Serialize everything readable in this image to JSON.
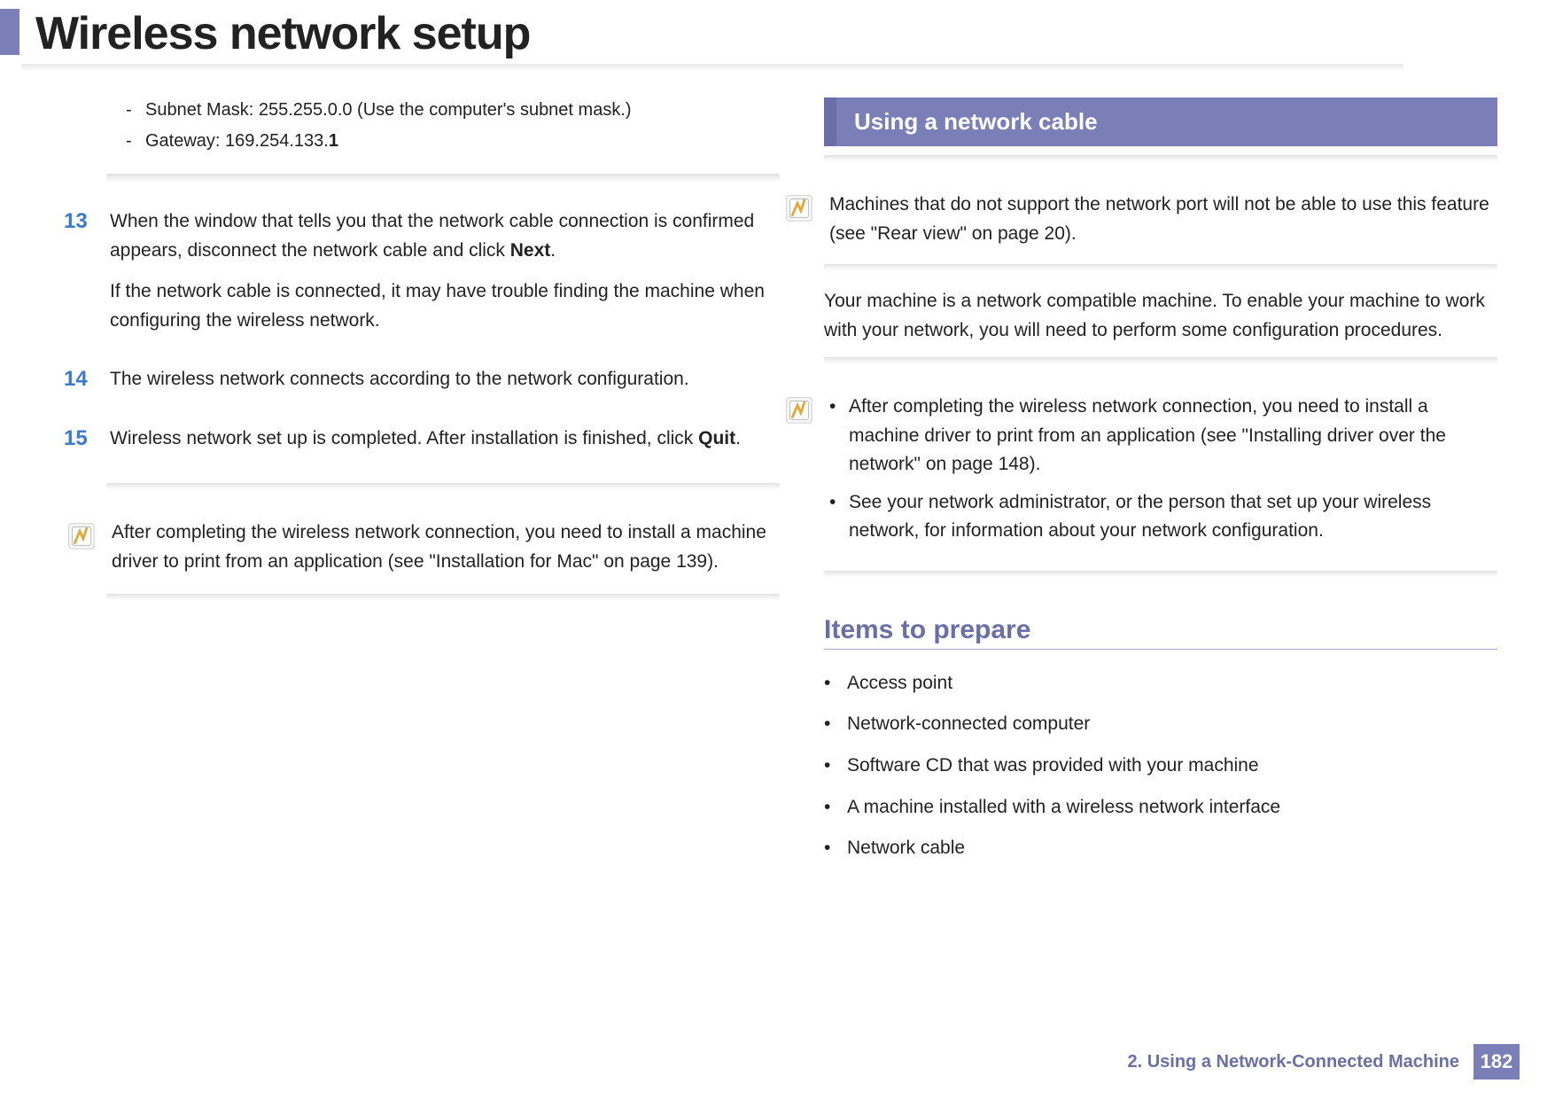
{
  "header": {
    "title": "Wireless network setup"
  },
  "left": {
    "sub_items": {
      "subnet_text": "Subnet Mask: 255.255.0.0 (Use the computer's subnet mask.)",
      "gateway_prefix": "Gateway: 169.254.133.",
      "gateway_bold": "1"
    },
    "steps": {
      "s13_num": "13",
      "s13_p1a": "When the window that tells you that the network cable connection is confirmed appears, disconnect the network cable and click ",
      "s13_p1b": "Next",
      "s13_p1c": ".",
      "s13_p2": "If the network cable is connected, it may have trouble finding the machine when configuring the wireless network.",
      "s14_num": "14",
      "s14_text": "The wireless network connects according to the network configuration.",
      "s15_num": "15",
      "s15_a": "Wireless network set up is completed. After installation is finished, click ",
      "s15_b": "Quit",
      "s15_c": "."
    },
    "note": {
      "text": "After completing the wireless network connection, you need to install a machine driver to print from an application (see \"Installation for Mac\" on page 139)."
    }
  },
  "right": {
    "section_title": "Using a network cable",
    "note1": {
      "text": "Machines that do not support the network port will not be able to use this feature (see \"Rear view\" on page 20)."
    },
    "intro": "Your machine is a network compatible machine. To enable your machine to work with your network, you will need to perform some configuration procedures.",
    "note2": {
      "b1": "After completing the wireless network connection, you need to install a machine driver to print from an application (see \"Installing driver over the network\" on page 148).",
      "b2": "See your network administrator, or the person that set up your wireless network, for information about your network configuration."
    },
    "items_heading": "Items to prepare",
    "items": [
      "Access point",
      "Network-connected computer",
      "Software CD that was provided with your machine",
      "A machine installed with a wireless network interface",
      "Network cable"
    ]
  },
  "footer": {
    "chapter": "2.  Using a Network-Connected Machine",
    "page": "182"
  }
}
